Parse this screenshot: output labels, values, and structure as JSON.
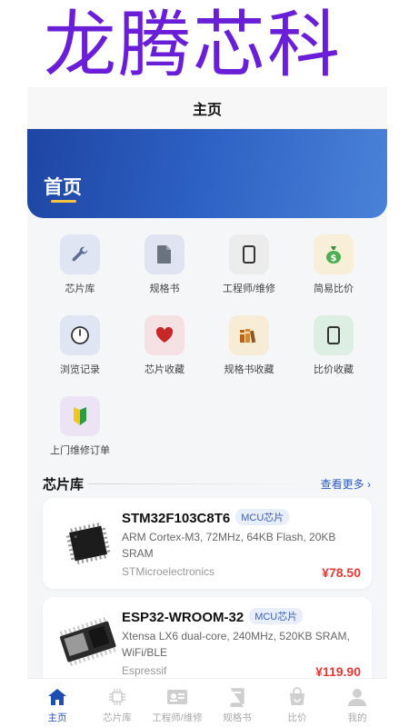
{
  "brand": {
    "title": "龙腾芯科"
  },
  "nav": {
    "title": "主页"
  },
  "hero": {
    "title": "首页"
  },
  "colors": {
    "accent": "#1f4fb5",
    "brand_purple": "#6a1ed8",
    "price_red": "#e53935"
  },
  "grid": [
    {
      "label": "芯片库",
      "icon": "wrench-icon"
    },
    {
      "label": "规格书",
      "icon": "document-icon"
    },
    {
      "label": "工程师/维修",
      "icon": "phone-icon"
    },
    {
      "label": "简易比价",
      "icon": "money-bag-icon"
    },
    {
      "label": "浏览记录",
      "icon": "clock-icon"
    },
    {
      "label": "芯片收藏",
      "icon": "heart-icon"
    },
    {
      "label": "规格书收藏",
      "icon": "books-icon"
    },
    {
      "label": "比价收藏",
      "icon": "phone-icon"
    },
    {
      "label": "上门维修订单",
      "icon": "beginner-badge-icon"
    }
  ],
  "section": {
    "title": "芯片库",
    "more": "查看更多 ›"
  },
  "chips": [
    {
      "name": "STM32F103C8T6",
      "tag": "MCU芯片",
      "desc": "ARM Cortex-M3, 72MHz, 64KB Flash, 20KB SRAM",
      "manufacturer": "STMicroelectronics",
      "price": "¥78.50"
    },
    {
      "name": "ESP32-WROOM-32",
      "tag": "MCU芯片",
      "desc": "Xtensa LX6 dual-core, 240MHz, 520KB SRAM, WiFi/BLE",
      "manufacturer": "Espressif",
      "price": "¥119.90"
    }
  ],
  "tabs": [
    {
      "label": "主页",
      "icon": "home-icon",
      "active": true
    },
    {
      "label": "芯片库",
      "icon": "chip-icon"
    },
    {
      "label": "工程师/维修",
      "icon": "id-card-icon"
    },
    {
      "label": "规格书",
      "icon": "book-icon"
    },
    {
      "label": "比价",
      "icon": "shopping-bag-icon"
    },
    {
      "label": "我的",
      "icon": "user-icon"
    }
  ]
}
